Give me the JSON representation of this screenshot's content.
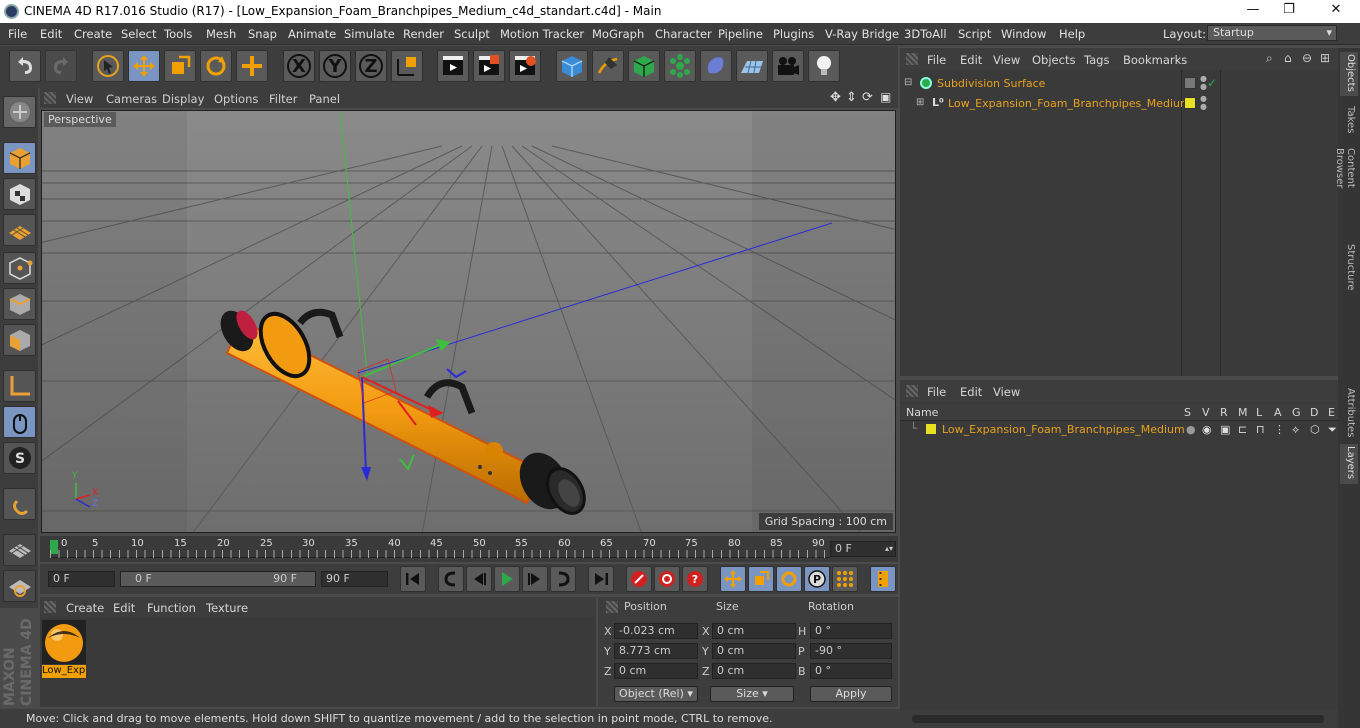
{
  "window": {
    "title": "CINEMA 4D R17.016 Studio (R17) - [Low_Expansion_Foam_Branchpipes_Medium_c4d_standart.c4d] - Main",
    "minimize": "—",
    "maximize": "❐",
    "close": "✕"
  },
  "menu": [
    "File",
    "Edit",
    "Create",
    "Select",
    "Tools",
    "Mesh",
    "Snap",
    "Animate",
    "Simulate",
    "Render",
    "Sculpt",
    "Motion Tracker",
    "MoGraph",
    "Character",
    "Pipeline",
    "Plugins",
    "V-Ray Bridge",
    "3DToAll",
    "Script",
    "Window",
    "Help"
  ],
  "layout": {
    "label": "Layout:",
    "value": "Startup"
  },
  "toolbar": {
    "x": "X",
    "y": "Y",
    "z": "Z"
  },
  "viewport": {
    "menu": [
      "View",
      "Cameras",
      "Display",
      "Options",
      "Filter",
      "Panel"
    ],
    "label": "Perspective",
    "grid_spacing": "Grid Spacing : 100 cm",
    "axis": {
      "y": "Y",
      "x": "X",
      "z": "Z"
    }
  },
  "timeline": {
    "ticks": [
      "0",
      "5",
      "10",
      "15",
      "20",
      "25",
      "30",
      "35",
      "40",
      "45",
      "50",
      "55",
      "60",
      "65",
      "70",
      "75",
      "80",
      "85",
      "90"
    ],
    "current": "0 F"
  },
  "transport": {
    "start": "0 F",
    "range_start": "0 F",
    "range_end": "90 F",
    "end": "90 F"
  },
  "material": {
    "menu": [
      "Create",
      "Edit",
      "Function",
      "Texture"
    ],
    "name": "Low_Exp"
  },
  "coords": {
    "headers": {
      "position": "Position",
      "size": "Size",
      "rotation": "Rotation"
    },
    "rows": [
      {
        "axis": "X",
        "pos": "-0.023 cm",
        "size_axis": "X",
        "size": "0 cm",
        "rot_axis": "H",
        "rot": "0 °"
      },
      {
        "axis": "Y",
        "pos": "8.773 cm",
        "size_axis": "Y",
        "size": "0 cm",
        "rot_axis": "P",
        "rot": "-90 °"
      },
      {
        "axis": "Z",
        "pos": "0 cm",
        "size_axis": "Z",
        "size": "0 cm",
        "rot_axis": "B",
        "rot": "0 °"
      }
    ],
    "mode": "Object (Rel)",
    "size_mode": "Size",
    "apply": "Apply"
  },
  "objects": {
    "menu": [
      "File",
      "Edit",
      "View",
      "Objects",
      "Tags",
      "Bookmarks"
    ],
    "items": [
      {
        "name": "Subdivision Surface"
      },
      {
        "name": "Low_Expansion_Foam_Branchpipes_Medium"
      }
    ]
  },
  "layers": {
    "menu": [
      "File",
      "Edit",
      "View"
    ],
    "col_name": "Name",
    "cols": [
      "S",
      "V",
      "R",
      "M",
      "L",
      "A",
      "G",
      "D",
      "E"
    ],
    "item": "Low_Expansion_Foam_Branchpipes_Medium"
  },
  "sidetabs": [
    "Objects",
    "Takes",
    "Content Browser",
    "Structure",
    "Attributes",
    "Layers"
  ],
  "status": "Move: Click and drag to move elements. Hold down SHIFT to quantize movement / add to the selection in point mode, CTRL to remove.",
  "colors": {
    "accent": "#7b95c2",
    "object_orange": "#e8a21c",
    "bg": "#4b4b4b"
  }
}
